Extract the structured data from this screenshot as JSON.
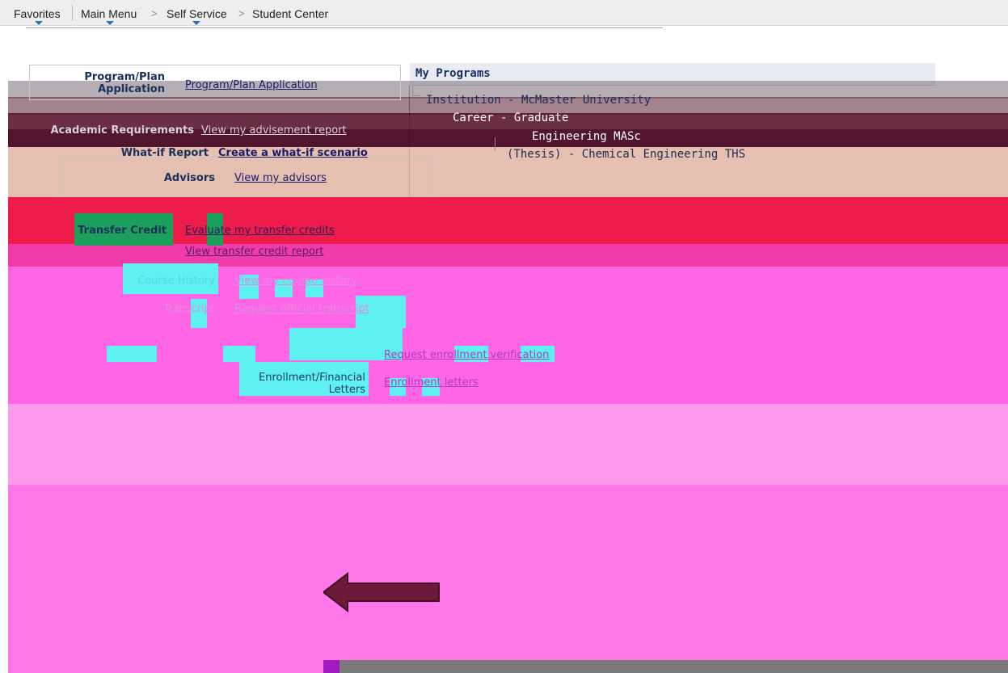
{
  "nav": {
    "favorites": "Favorites",
    "main_menu": "Main Menu",
    "sep1": ">",
    "self_service": "Self Service",
    "sep2": ">",
    "student_center": "Student Center"
  },
  "left_rows": [
    {
      "label": "Program/Plan Application",
      "link": "Program/Plan Application"
    },
    {
      "label": "Academic Requirements",
      "link": "View my advisement report"
    },
    {
      "label": "What-if Report",
      "link": "Create a what-if scenario"
    },
    {
      "label": "Advisors",
      "link": "View my advisors"
    },
    {
      "label": "Transfer Credit",
      "link": "Evaluate my transfer credits"
    },
    {
      "label": "",
      "link": "View transfer credit report"
    },
    {
      "label": "Course History",
      "link": "View my course history"
    },
    {
      "label": "Transcript",
      "link": "Request official transcript"
    },
    {
      "label": "",
      "link": "Request enrollment verification"
    },
    {
      "label": "Enrollment/Financial Letters",
      "link": "Enrollment letters"
    }
  ],
  "programs": {
    "title": "My Programs",
    "institution": "Institution - McMaster University",
    "career": "Career - Graduate",
    "program": "Engineering MASc",
    "plan": "(Thesis) - Chemical Engineering THS"
  },
  "colors": {
    "nav_bg": "#eeeeee",
    "link": "#1a1a6b",
    "label": "#1a2f5a",
    "arrow": "#6b1a3a"
  }
}
